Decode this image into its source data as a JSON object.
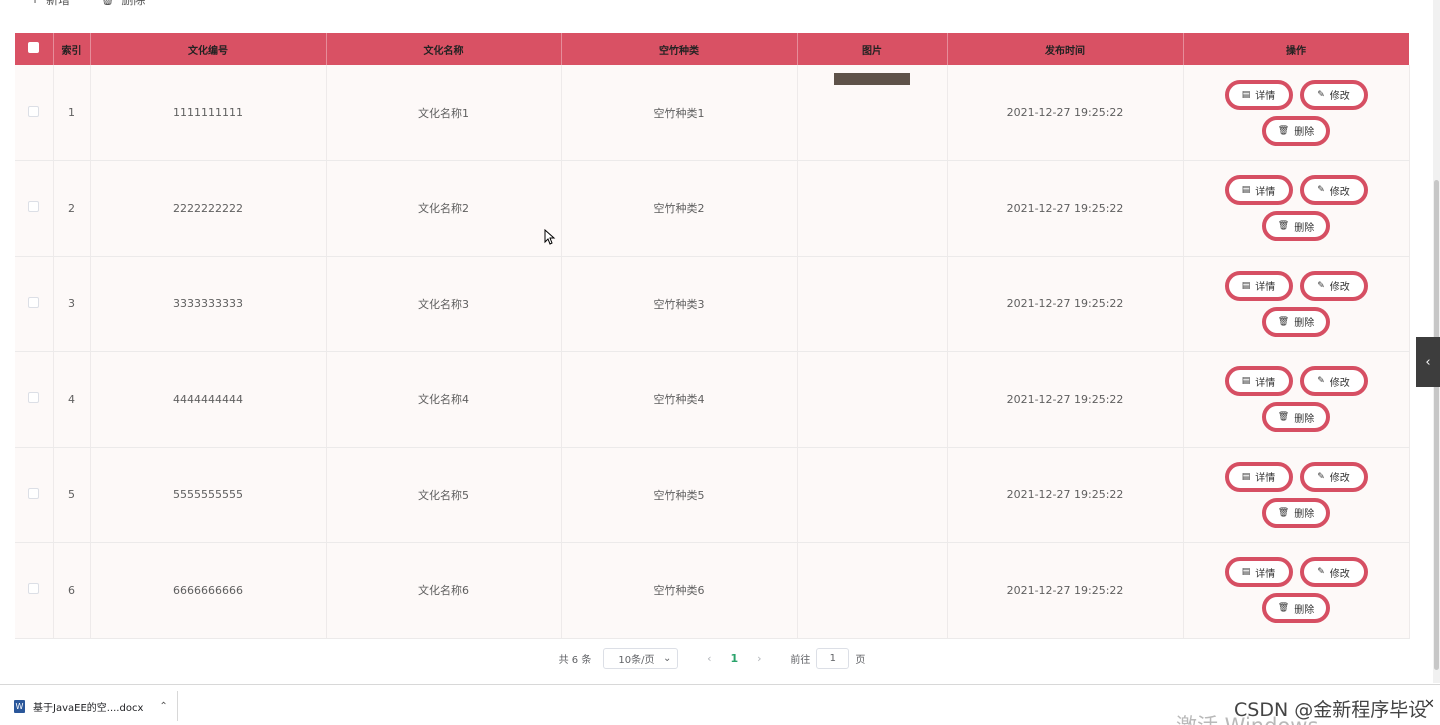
{
  "toolbar": {
    "add_label": "新增",
    "delete_label": "删除"
  },
  "table": {
    "headers": [
      "索引",
      "文化编号",
      "文化名称",
      "空竹种类",
      "图片",
      "发布时间",
      "操作"
    ],
    "rows": [
      {
        "index": "1",
        "code": "1111111111",
        "name": "文化名称1",
        "kind": "空竹种类1",
        "time": "2021-12-27 19:25:22"
      },
      {
        "index": "2",
        "code": "2222222222",
        "name": "文化名称2",
        "kind": "空竹种类2",
        "time": "2021-12-27 19:25:22"
      },
      {
        "index": "3",
        "code": "3333333333",
        "name": "文化名称3",
        "kind": "空竹种类3",
        "time": "2021-12-27 19:25:22"
      },
      {
        "index": "4",
        "code": "4444444444",
        "name": "文化名称4",
        "kind": "空竹种类4",
        "time": "2021-12-27 19:25:22"
      },
      {
        "index": "5",
        "code": "5555555555",
        "name": "文化名称5",
        "kind": "空竹种类5",
        "time": "2021-12-27 19:25:22"
      },
      {
        "index": "6",
        "code": "6666666666",
        "name": "文化名称6",
        "kind": "空竹种类6",
        "time": "2021-12-27 19:25:22"
      }
    ],
    "actions": {
      "detail": "详情",
      "edit": "修改",
      "delete": "删除"
    }
  },
  "pagination": {
    "total": "共 6 条",
    "page_size": "10条/页",
    "current_page": "1",
    "goto_prefix": "前往",
    "goto_value": "1",
    "goto_suffix": "页"
  },
  "download_bar": {
    "file_name": "基于JavaEE的空....docx"
  },
  "watermark": {
    "csdn": "CSDN @金新程序毕设",
    "windows": "激活 Windows"
  },
  "colors": {
    "header_bg": "#d95164",
    "action_border": "#d64f63",
    "row_bg": "#fdf9f8",
    "page_active": "#2aa36b"
  }
}
